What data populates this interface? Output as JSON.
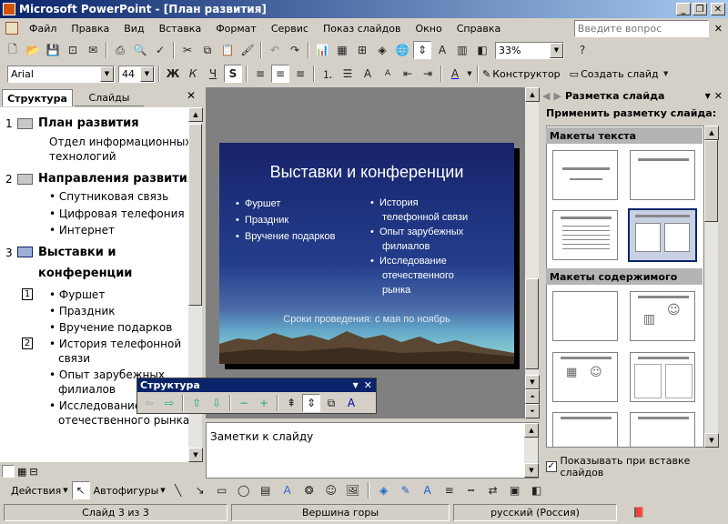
{
  "window": {
    "title": "Microsoft PowerPoint - [План развития]",
    "min": "_",
    "max": "❐",
    "close": "✕"
  },
  "menu": [
    "Файл",
    "Правка",
    "Вид",
    "Вставка",
    "Формат",
    "Сервис",
    "Показ слайдов",
    "Окно",
    "Справка"
  ],
  "help_placeholder": "Введите вопрос",
  "toolbar": {
    "zoom": "33%",
    "font": "Arial",
    "size": "44",
    "bold": "Ж",
    "italic": "К",
    "underline": "Ч",
    "shadow": "S",
    "designer": "Конструктор",
    "new_slide": "Создать слайд"
  },
  "outline": {
    "tabs": {
      "structure": "Структура",
      "slides": "Слайды"
    },
    "slides": [
      {
        "num": "1",
        "title": "План развития",
        "body": [
          "Отдел информационных",
          "технологий"
        ]
      },
      {
        "num": "2",
        "title": "Направления развития",
        "bullets": [
          "Спутниковая связь",
          "Цифровая телефония",
          "Интернет"
        ]
      },
      {
        "num": "3",
        "title": [
          "Выставки и",
          "конференции"
        ],
        "col1_num": "1",
        "col1": [
          "Фуршет",
          "Праздник",
          "Вручение подарков"
        ],
        "col2_num": "2",
        "col2": [
          "История телефонной",
          "связи",
          "Опыт зарубежных",
          "филиалов",
          "Исследование",
          "отечественного рынка"
        ]
      }
    ]
  },
  "slide": {
    "title": "Выставки и конференции",
    "left": [
      "Фуршет",
      "Праздник",
      "Вручение подарков"
    ],
    "right": [
      [
        "История",
        "телефонной связи"
      ],
      [
        "Опыт зарубежных",
        "филиалов"
      ],
      [
        "Исследование",
        "отечественного",
        "рынка"
      ]
    ],
    "footer": "Сроки проведения: с мая по ноябрь"
  },
  "notes_placeholder": "Заметки к слайду",
  "float_toolbar": {
    "title": "Структура"
  },
  "taskpane": {
    "title": "Разметка слайда",
    "apply": "Применить разметку слайда:",
    "text_layouts": "Макеты текста",
    "content_layouts": "Макеты содержимого",
    "show_on_insert": "Показывать при вставке слайдов"
  },
  "drawbar": {
    "actions": "Действия",
    "autoshapes": "Автофигуры"
  },
  "status": {
    "slide": "Слайд 3 из 3",
    "design": "Вершина горы",
    "language": "русский (Россия)"
  },
  "colors": {
    "title_gradient_start": "#0a246a",
    "selection": "#0a246a",
    "slide_top": "#17236b"
  }
}
